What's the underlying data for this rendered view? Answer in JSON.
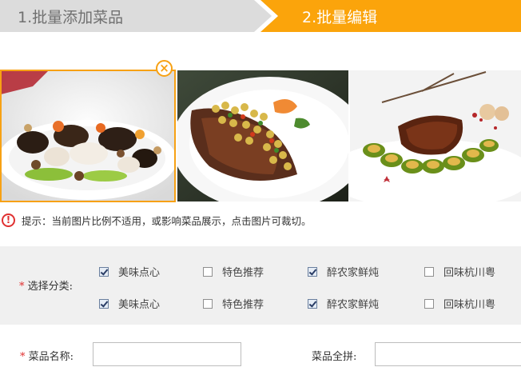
{
  "steps": {
    "step1_label": "1.批量添加菜品",
    "step2_label": "2.批量编辑",
    "active_color": "#fba40b",
    "inactive_color": "#dcdcdc"
  },
  "photos": {
    "items": [
      {
        "name": "dish-photo-1",
        "selected": true
      },
      {
        "name": "dish-photo-2",
        "selected": false
      },
      {
        "name": "dish-photo-3",
        "selected": false
      }
    ],
    "close_glyph": "×",
    "selection_color": "#f7a114"
  },
  "tip": {
    "icon_glyph": "!",
    "text": "提示：当前图片比例不适用，或影响菜品展示，点击图片可裁切。"
  },
  "category": {
    "required_mark": "*",
    "label": "选择分类:",
    "rows": [
      [
        {
          "label": "美味点心",
          "checked": true
        },
        {
          "label": "特色推荐",
          "checked": false
        },
        {
          "label": "醉农家鲜炖",
          "checked": true
        },
        {
          "label": "回味杭川粤",
          "checked": false
        }
      ],
      [
        {
          "label": "美味点心",
          "checked": true
        },
        {
          "label": "特色推荐",
          "checked": false
        },
        {
          "label": "醉农家鲜炖",
          "checked": true
        },
        {
          "label": "回味杭川粤",
          "checked": false
        }
      ]
    ]
  },
  "fields": {
    "required_mark": "*",
    "name_label": "菜品名称:",
    "name_value": "",
    "pinyin_label": "菜品全拼:",
    "pinyin_value": ""
  }
}
